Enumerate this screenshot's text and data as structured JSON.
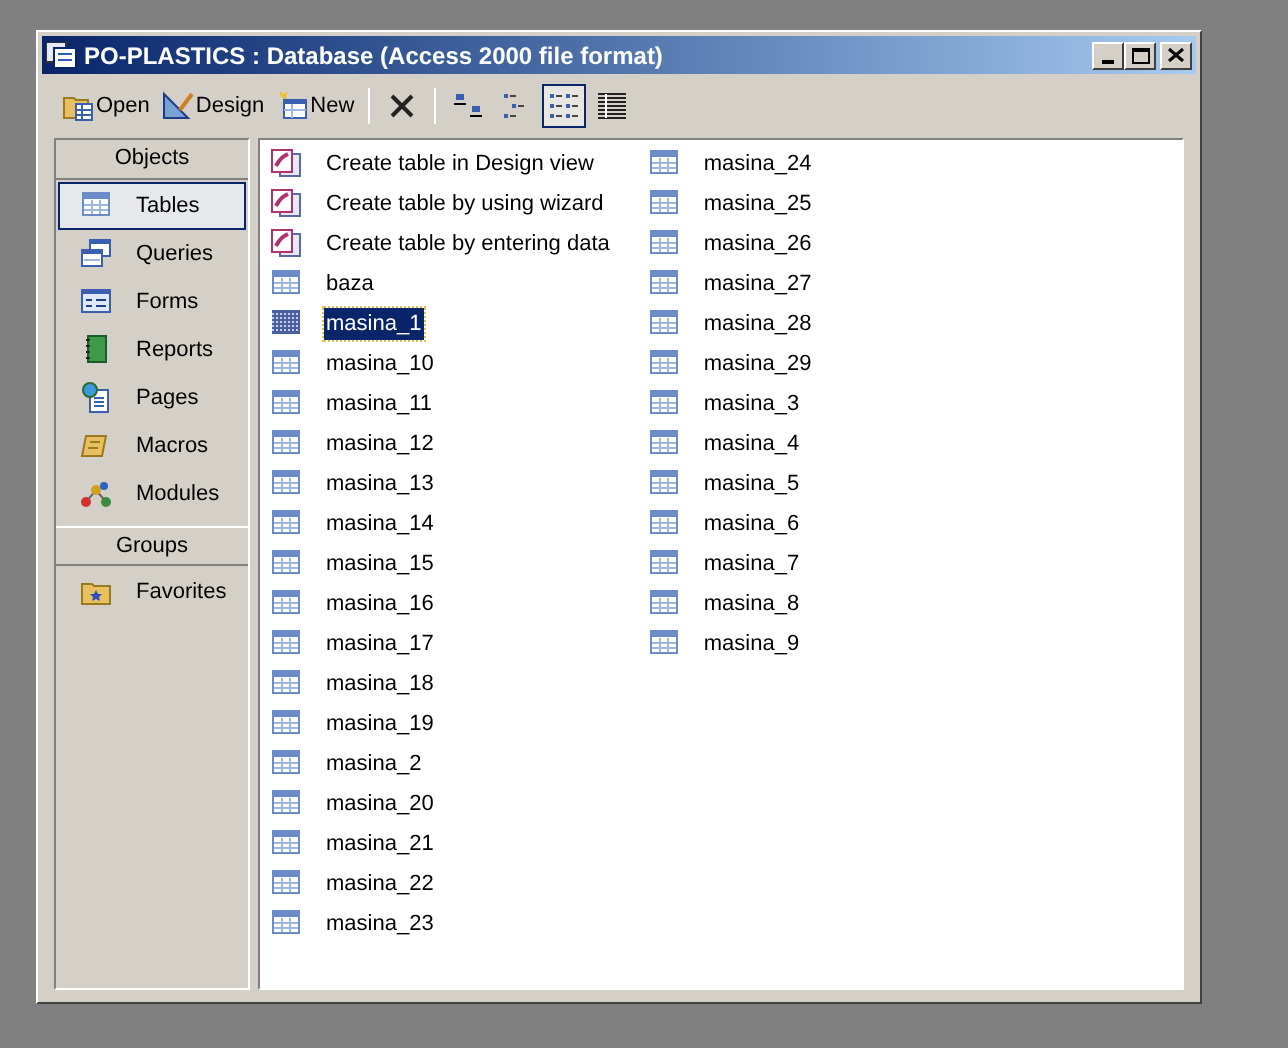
{
  "window": {
    "title": "PO-PLASTICS : Database (Access 2000 file format)"
  },
  "toolbar": {
    "buttons": [
      {
        "kind": "open",
        "label": "Open"
      },
      {
        "kind": "design",
        "label": "Design"
      },
      {
        "kind": "new",
        "label": "New"
      }
    ],
    "views": [
      {
        "kind": "large",
        "selected": false
      },
      {
        "kind": "small",
        "selected": false
      },
      {
        "kind": "list",
        "selected": true
      },
      {
        "kind": "details",
        "selected": false
      }
    ]
  },
  "sidebar": {
    "sections": [
      {
        "header": "Objects",
        "items": [
          {
            "kind": "tables",
            "label": "Tables",
            "selected": true
          },
          {
            "kind": "queries",
            "label": "Queries",
            "selected": false
          },
          {
            "kind": "forms",
            "label": "Forms",
            "selected": false
          },
          {
            "kind": "reports",
            "label": "Reports",
            "selected": false
          },
          {
            "kind": "pages",
            "label": "Pages",
            "selected": false
          },
          {
            "kind": "macros",
            "label": "Macros",
            "selected": false
          },
          {
            "kind": "modules",
            "label": "Modules",
            "selected": false
          }
        ]
      },
      {
        "header": "Groups",
        "items": [
          {
            "kind": "favorites",
            "label": "Favorites",
            "selected": false
          }
        ]
      }
    ]
  },
  "list": {
    "items": [
      {
        "kind": "create",
        "label": "Create table in Design view",
        "selected": false
      },
      {
        "kind": "create",
        "label": "Create table by using wizard",
        "selected": false
      },
      {
        "kind": "create",
        "label": "Create table by entering data",
        "selected": false
      },
      {
        "kind": "table",
        "label": "baza",
        "selected": false
      },
      {
        "kind": "table",
        "label": "masina_1",
        "selected": true
      },
      {
        "kind": "table",
        "label": "masina_10",
        "selected": false
      },
      {
        "kind": "table",
        "label": "masina_11",
        "selected": false
      },
      {
        "kind": "table",
        "label": "masina_12",
        "selected": false
      },
      {
        "kind": "table",
        "label": "masina_13",
        "selected": false
      },
      {
        "kind": "table",
        "label": "masina_14",
        "selected": false
      },
      {
        "kind": "table",
        "label": "masina_15",
        "selected": false
      },
      {
        "kind": "table",
        "label": "masina_16",
        "selected": false
      },
      {
        "kind": "table",
        "label": "masina_17",
        "selected": false
      },
      {
        "kind": "table",
        "label": "masina_18",
        "selected": false
      },
      {
        "kind": "table",
        "label": "masina_19",
        "selected": false
      },
      {
        "kind": "table",
        "label": "masina_2",
        "selected": false
      },
      {
        "kind": "table",
        "label": "masina_20",
        "selected": false
      },
      {
        "kind": "table",
        "label": "masina_21",
        "selected": false
      },
      {
        "kind": "table",
        "label": "masina_22",
        "selected": false
      },
      {
        "kind": "table",
        "label": "masina_23",
        "selected": false
      },
      {
        "kind": "table",
        "label": "masina_24",
        "selected": false
      },
      {
        "kind": "table",
        "label": "masina_25",
        "selected": false
      },
      {
        "kind": "table",
        "label": "masina_26",
        "selected": false
      },
      {
        "kind": "table",
        "label": "masina_27",
        "selected": false
      },
      {
        "kind": "table",
        "label": "masina_28",
        "selected": false
      },
      {
        "kind": "table",
        "label": "masina_29",
        "selected": false
      },
      {
        "kind": "table",
        "label": "masina_3",
        "selected": false
      },
      {
        "kind": "table",
        "label": "masina_4",
        "selected": false
      },
      {
        "kind": "table",
        "label": "masina_5",
        "selected": false
      },
      {
        "kind": "table",
        "label": "masina_6",
        "selected": false
      },
      {
        "kind": "table",
        "label": "masina_7",
        "selected": false
      },
      {
        "kind": "table",
        "label": "masina_8",
        "selected": false
      },
      {
        "kind": "table",
        "label": "masina_9",
        "selected": false
      }
    ]
  }
}
